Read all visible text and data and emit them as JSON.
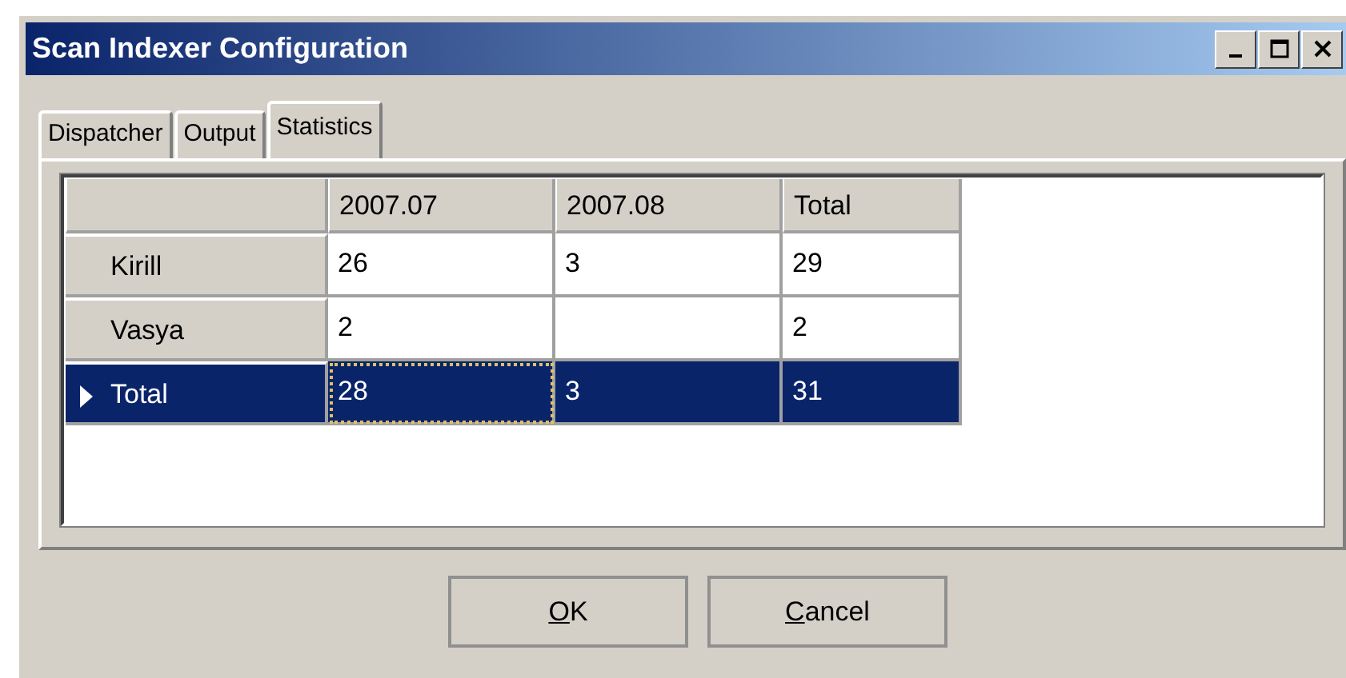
{
  "window": {
    "title": "Scan Indexer Configuration"
  },
  "title_buttons": [
    {
      "kind": "minimize"
    },
    {
      "kind": "maximize"
    },
    {
      "kind": "close"
    }
  ],
  "tabs": [
    {
      "label": "Dispatcher",
      "selected": false
    },
    {
      "label": "Output",
      "selected": false
    },
    {
      "label": "Statistics",
      "selected": true
    }
  ],
  "grid": {
    "columns": [
      "2007.07",
      "2007.08",
      "Total"
    ],
    "rows": [
      {
        "header": "Kirill",
        "cells": [
          "26",
          "3",
          "29"
        ],
        "selected": false
      },
      {
        "header": "Vasya",
        "cells": [
          "2",
          null,
          "2"
        ],
        "selected": false
      },
      {
        "header": "Total",
        "cells": [
          "28",
          "3",
          "31"
        ],
        "selected": true,
        "focused_cell": true
      }
    ]
  },
  "buttons": [
    {
      "label": "OK"
    },
    {
      "label": "Cancel"
    }
  ]
}
